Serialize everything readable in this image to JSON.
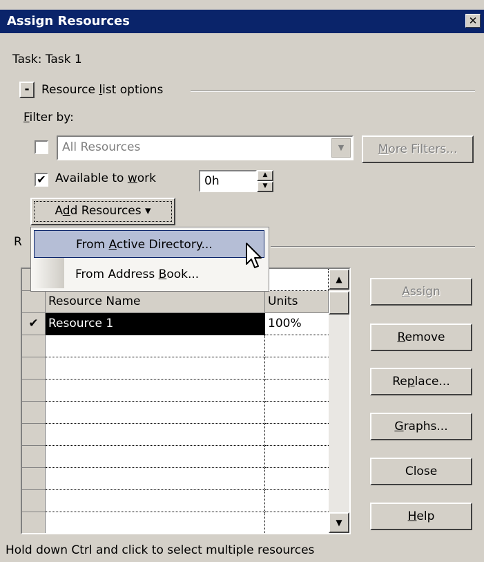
{
  "window": {
    "title": "Assign Resources",
    "close_glyph": "✕"
  },
  "task": {
    "label": "Task: Task 1"
  },
  "options": {
    "toggle_glyph": "-",
    "label_pre": "Resource ",
    "label_u": "l",
    "label_post": "ist options",
    "filter_label_u": "F",
    "filter_label_post": "ilter by:",
    "filter_checked": false,
    "filter_value": "All Resources",
    "more_filters_u": "M",
    "more_filters_post": "ore Filters...",
    "available_checked": true,
    "available_pre": "Available to ",
    "available_u": "w",
    "available_post": "ork",
    "available_value": "0h",
    "add_pre": "A",
    "add_u": "d",
    "add_post": "d Resources ▾"
  },
  "menu": {
    "items": [
      {
        "pre": "From ",
        "u": "A",
        "post": "ctive Directory...",
        "highlighted": true
      },
      {
        "pre": "From Address ",
        "u": "B",
        "post": "ook...",
        "highlighted": false
      }
    ]
  },
  "section_label_partial": "R",
  "table": {
    "columns": [
      "Resource Name",
      "Units"
    ],
    "rows": [
      {
        "check": "✔",
        "name": "Resource 1",
        "units": "100%"
      }
    ],
    "empty_rows": 9
  },
  "buttons": {
    "assign": {
      "pre": "",
      "u": "A",
      "post": "ssign"
    },
    "remove": {
      "pre": "",
      "u": "R",
      "post": "emove"
    },
    "replace": {
      "pre": "Re",
      "u": "p",
      "post": "lace..."
    },
    "graphs": {
      "pre": "",
      "u": "G",
      "post": "raphs..."
    },
    "close": {
      "label": "Close"
    },
    "help": {
      "pre": "",
      "u": "H",
      "post": "elp"
    }
  },
  "footer": "Hold down Ctrl and click to select multiple resources",
  "colors": {
    "titlebar": "#0a246a",
    "dialog": "#d4d0c8",
    "menu_highlight": "#b5bed6"
  }
}
